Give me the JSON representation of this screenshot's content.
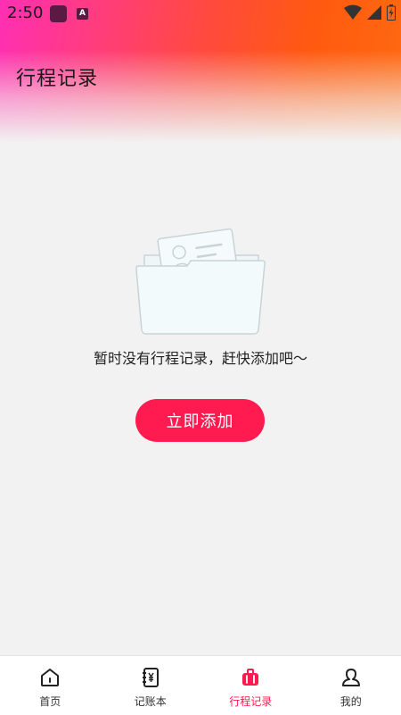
{
  "status_bar": {
    "time": "2:50"
  },
  "header": {
    "title": "行程记录"
  },
  "empty_state": {
    "icon": "folder-document-icon",
    "message": "暂时没有行程记录，赶快添加吧～",
    "button_label": "立即添加"
  },
  "bottom_nav": {
    "items": [
      {
        "label": "首页",
        "icon": "home-icon",
        "active": false
      },
      {
        "label": "记账本",
        "icon": "ledger-icon",
        "active": false
      },
      {
        "label": "行程记录",
        "icon": "suitcase-icon",
        "active": true
      },
      {
        "label": "我的",
        "icon": "person-icon",
        "active": false
      }
    ]
  },
  "colors": {
    "accent": "#ff1a4f",
    "header_gradient_start": "#ff2fb4",
    "header_gradient_end": "#ff6a10",
    "background": "#f2f2f2"
  }
}
